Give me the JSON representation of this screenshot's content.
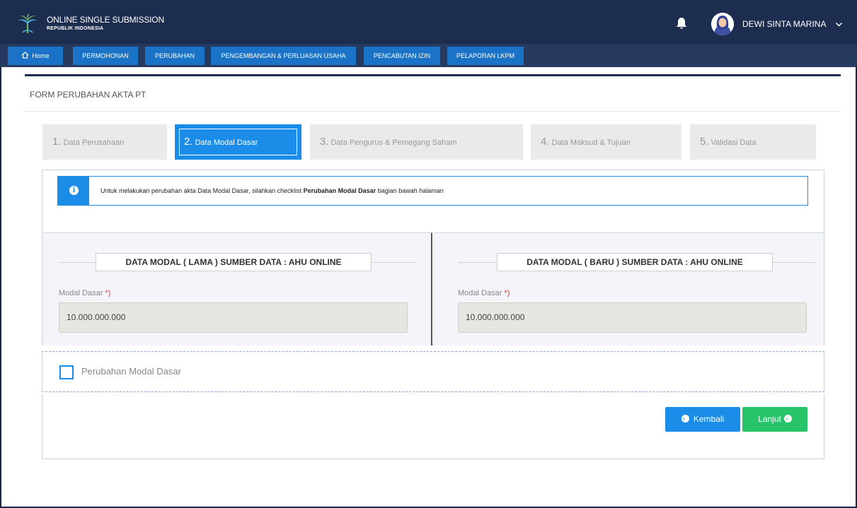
{
  "header": {
    "brand_title": "ONLINE SINGLE SUBMISSION",
    "brand_subtitle": "REPUBLIK INDONESIA",
    "user_name": "DEWI SINTA MARINA",
    "logo_icon": "oss-tree-logo-icon",
    "bell_icon": "bell-icon",
    "caret_icon": "chevron-down-icon"
  },
  "nav": {
    "items": [
      {
        "label": "Home",
        "icon": "home-icon"
      },
      {
        "label": "PERMOHONAN"
      },
      {
        "label": "PERUBAHAN"
      },
      {
        "label": "PENGEMBANGAN & PERLUASAN USAHA"
      },
      {
        "label": "PENCABUTAN IZIN"
      },
      {
        "label": "PELAPORAN LKPM"
      }
    ]
  },
  "form": {
    "title": "FORM PERUBAHAN AKTA PT",
    "steps": [
      {
        "num": "1.",
        "label": "Data Perusahaan"
      },
      {
        "num": "2.",
        "label": "Data Modal Dasar"
      },
      {
        "num": "3.",
        "label": "Data Pengurus & Pemegang Saham"
      },
      {
        "num": "4.",
        "label": "Data Maksud & Tujuan"
      },
      {
        "num": "5.",
        "label": "Validasi Data"
      }
    ],
    "active_step": 2,
    "info": {
      "prefix": "Untuk melakukan perubahan akta Data Modal Dasar, silahkan checklist ",
      "bold": "Perubahan Modal Dasar",
      "suffix": " bagian bawah halaman"
    },
    "old_panel": {
      "legend": "DATA MODAL ( LAMA ) SUMBER DATA : AHU ONLINE",
      "label": "Modal Dasar",
      "required": "*)",
      "value": "10.000.000.000"
    },
    "new_panel": {
      "legend": "DATA MODAL ( BARU ) SUMBER DATA : AHU ONLINE",
      "label": "Modal Dasar",
      "required": "*)",
      "value": "10.000.000.000"
    },
    "checkbox_label": "Perubahan Modal Dasar",
    "checkbox_checked": false,
    "back_label": "Kembali",
    "next_label": "Lanjut"
  },
  "colors": {
    "header_bg": "#1d2d50",
    "nav_bg": "#26395f",
    "primary": "#1b8ce8",
    "success": "#27c46a",
    "required": "#e23b3b"
  }
}
